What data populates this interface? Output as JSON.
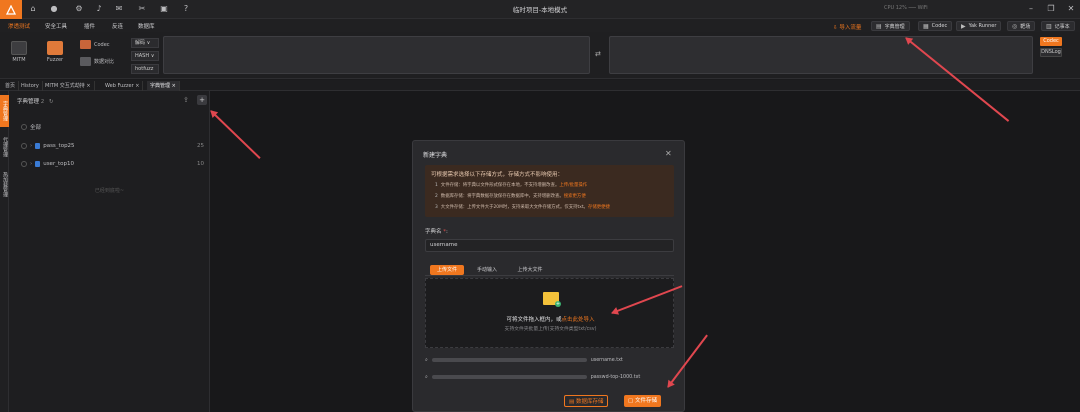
{
  "window": {
    "title": "临时项目-本地模式",
    "cpu": "CPU 12%",
    "wifi": "WiFi"
  },
  "menu": {
    "items": [
      "渗透测试",
      "安全工具",
      "插件",
      "反连",
      "数据库"
    ]
  },
  "toolbar": {
    "mitm": "MITM",
    "fuzzer": "Fuzzer",
    "codec": "Codec",
    "compare": "数据对比",
    "decode": "解码",
    "hash": "HASH",
    "hotpatch": "hotfuzz",
    "import": "导入流量",
    "right_buttons": [
      "字典管理",
      "Codec",
      "Yak Runner",
      "靶场",
      "记事本"
    ],
    "side_btns": [
      "Codec",
      "DNSLog"
    ]
  },
  "tabs": [
    {
      "label": "首页"
    },
    {
      "label": "History"
    },
    {
      "label": "MITM 交互式劫持"
    },
    {
      "label": "Web Fuzzer"
    },
    {
      "label": "字典管理",
      "active": true
    }
  ],
  "left_strip": [
    "字典管理",
    "代理管理",
    "热加载管理"
  ],
  "panel": {
    "title": "字典管理",
    "count": "2",
    "all": "全部",
    "items": [
      {
        "name": "pass_top25",
        "count": "25"
      },
      {
        "name": "user_top10",
        "count": "10"
      }
    ],
    "empty": "已经到底啦~"
  },
  "modal": {
    "title": "新建字典",
    "alert_head": "可根据需求选择以下存储方式，存储方式不影响使用：",
    "alert_items": [
      {
        "n": "1",
        "text": "文件存储：将字典以文件形式保存在本地，不支持增删改查。",
        "link": "上传/批量操作"
      },
      {
        "n": "2",
        "text": "数据库存储：将字典数据存放保存在数据库中，支持增删改查。",
        "link": "搜索更方便"
      },
      {
        "n": "3",
        "text": "大文件存储：上传文件大于20M时，支持采取大文件存储方式。仅支持txt。",
        "link": "存储更便捷"
      }
    ],
    "name_label": "字典名",
    "name_value": "username",
    "upload_tabs": [
      "上传文件",
      "手动输入",
      "上传大文件"
    ],
    "drop_main": "可将文件拖入框内，或",
    "drop_link": "点击此处导入",
    "drop_hint": "支持文件夹批量上传(支持文件类型txt/csv)",
    "files": [
      "username.txt",
      "passwd-top-1000.txt"
    ],
    "btn_db": "数据库存储",
    "btn_file": "文件存储"
  }
}
